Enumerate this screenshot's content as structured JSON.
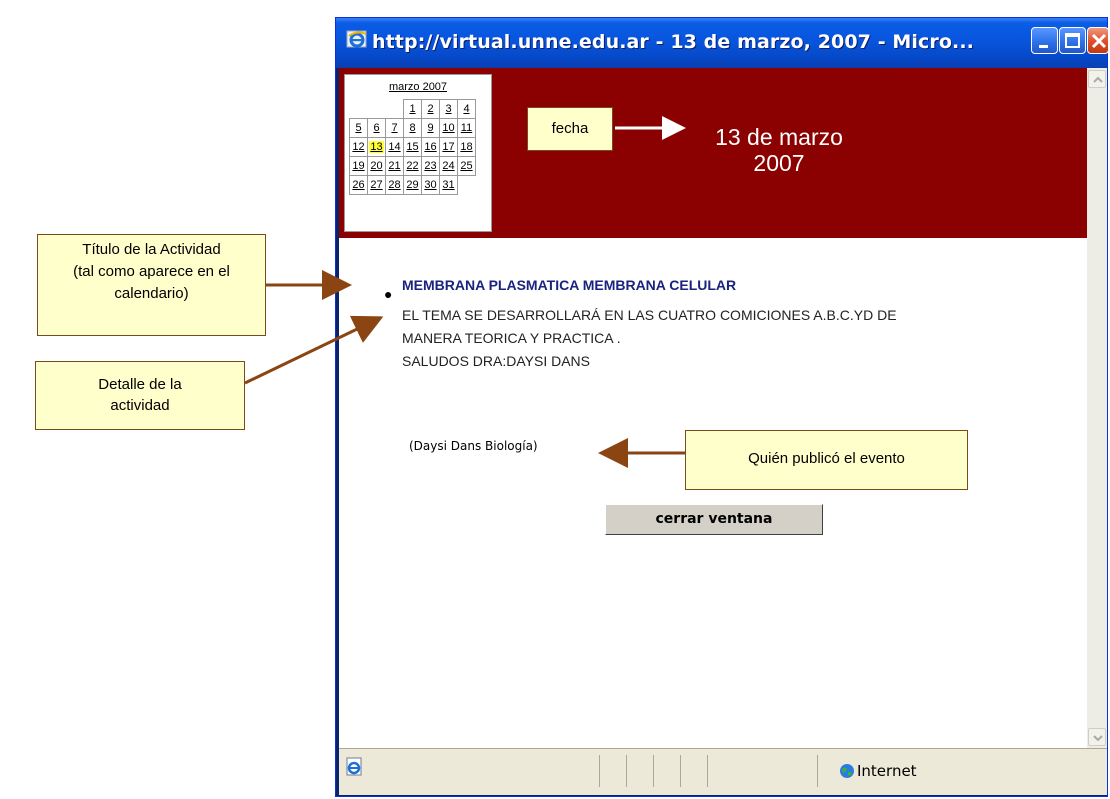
{
  "window": {
    "title": "http://virtual.unne.edu.ar - 13 de marzo, 2007 - Micro..."
  },
  "calendar": {
    "month_label": "marzo 2007",
    "weeks": [
      [
        "",
        "",
        "",
        "1",
        "2",
        "3",
        "4"
      ],
      [
        "5",
        "6",
        "7",
        "8",
        "9",
        "10",
        "11"
      ],
      [
        "12",
        "13",
        "14",
        "15",
        "16",
        "17",
        "18"
      ],
      [
        "19",
        "20",
        "21",
        "22",
        "23",
        "24",
        "25"
      ],
      [
        "26",
        "27",
        "28",
        "29",
        "30",
        "31",
        ""
      ]
    ],
    "highlighted_day": "13"
  },
  "date_display": {
    "line1": "13 de marzo",
    "line2": "2007"
  },
  "activity": {
    "title": "MEMBRANA PLASMATICA MEMBRANA CELULAR",
    "detail_lines": [
      "EL TEMA SE DESARROLLARÁ EN LAS CUATRO COMICIONES A.B.C.YD DE",
      "MANERA TEORICA Y PRACTICA .",
      "SALUDOS DRA:DAYSI DANS"
    ],
    "publisher": "(Daysi Dans Biología)"
  },
  "buttons": {
    "close": "cerrar ventana"
  },
  "statusbar": {
    "zone": "Internet"
  },
  "annotations": {
    "fecha": "fecha",
    "titulo": [
      "Título de la Actividad",
      "(tal como aparece en el",
      "calendario)"
    ],
    "detalle": [
      "Detalle de la",
      "actividad"
    ],
    "quien": "Quién publicó el evento"
  },
  "colors": {
    "banner": "#8b0000",
    "title_text": "#1a237e",
    "callout_bg": "#ffffcc",
    "arrow": "#8b4513",
    "today_highlight": "#ffff33"
  }
}
